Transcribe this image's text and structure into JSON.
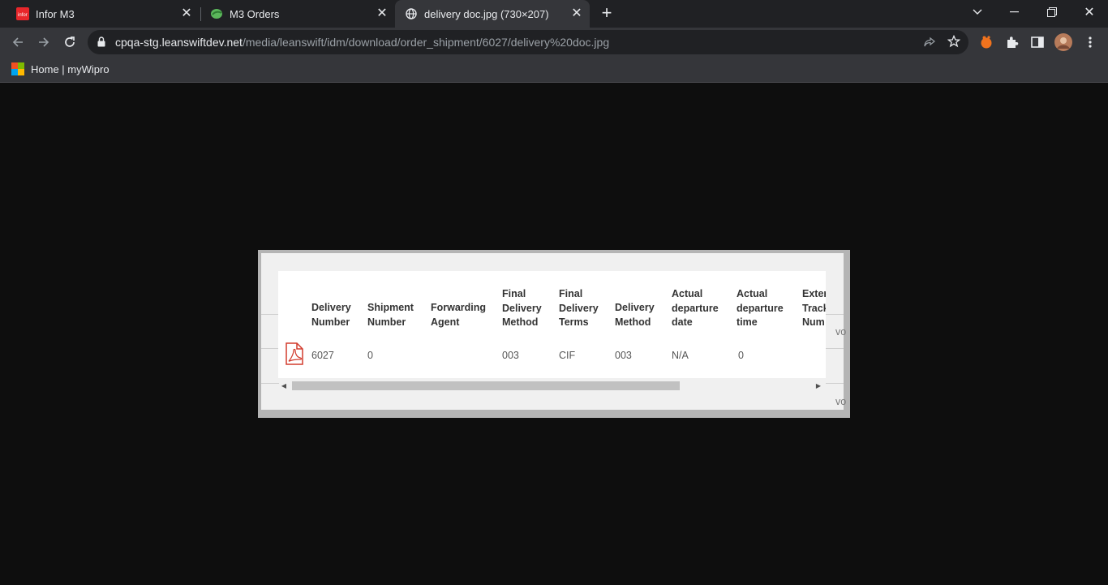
{
  "tabs": [
    {
      "label": "Infor M3",
      "favicon": "infor-icon"
    },
    {
      "label": "M3 Orders",
      "favicon": "m3-orders-icon"
    },
    {
      "label": "delivery doc.jpg (730×207)",
      "favicon": "globe-icon"
    }
  ],
  "address": {
    "host": "cpqa-stg.leanswiftdev.net",
    "path": "/media/leanswift/idm/download/order_shipment/6027/delivery%20doc.jpg"
  },
  "bookmarks": [
    {
      "label": "Home | myWipro"
    }
  ],
  "image": {
    "headers": [
      [
        "Delivery",
        "Number"
      ],
      [
        "Shipment",
        "Number"
      ],
      [
        "Forwarding",
        "Agent"
      ],
      [
        "Final",
        "Delivery",
        "Method"
      ],
      [
        "Final",
        "Delivery",
        "Terms"
      ],
      [
        "Delivery",
        "Method"
      ],
      [
        "Actual",
        "departure",
        "date"
      ],
      [
        "Actual",
        "departure",
        "time"
      ],
      [
        "Exter",
        "Track",
        "Num"
      ]
    ],
    "row": [
      "6027",
      "0",
      "",
      "003",
      "CIF",
      "003",
      "N/A",
      "0",
      ""
    ],
    "ghost_right": [
      "vo",
      "vo"
    ]
  },
  "colors": {
    "tabbar": "#202124",
    "toolbar": "#35363a",
    "viewer_bg": "#0e0e0e",
    "pdf_red": "#d23b2d"
  }
}
